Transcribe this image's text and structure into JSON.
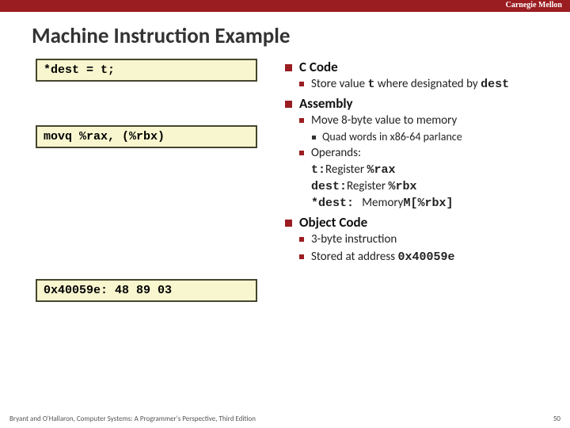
{
  "header": {
    "corner": "Carnegie Mellon",
    "title": "Machine Instruction Example"
  },
  "codeboxes": {
    "c": "*dest = t;",
    "asm": "movq %rax, (%rbx)",
    "obj": "0x40059e:  48 89 03"
  },
  "sections": {
    "c": {
      "title": "C Code",
      "bullets": {
        "store_pre": "Store value ",
        "store_mono1": "t",
        "store_mid": " where designated by ",
        "store_mono2": "dest"
      }
    },
    "asm": {
      "title": "Assembly",
      "move": "Move 8-byte value to memory",
      "quad": "Quad words in x86-64 parlance",
      "operands_label": "Operands:",
      "t_label": "t:",
      "t_desc": "Register ",
      "t_reg": "%rax",
      "dest_label": "dest:",
      "dest_desc": "Register ",
      "dest_reg": "%rbx",
      "star_label": "*dest:",
      "star_desc": "Memory",
      "star_mem": "M[%rbx]"
    },
    "obj": {
      "title": "Object Code",
      "b1": "3-byte instruction",
      "b2_pre": "Stored at address ",
      "b2_mono": "0x40059e"
    }
  },
  "footer": {
    "credit": "Bryant and O'Hallaron, Computer Systems: A Programmer's Perspective, Third Edition",
    "page": "50"
  }
}
